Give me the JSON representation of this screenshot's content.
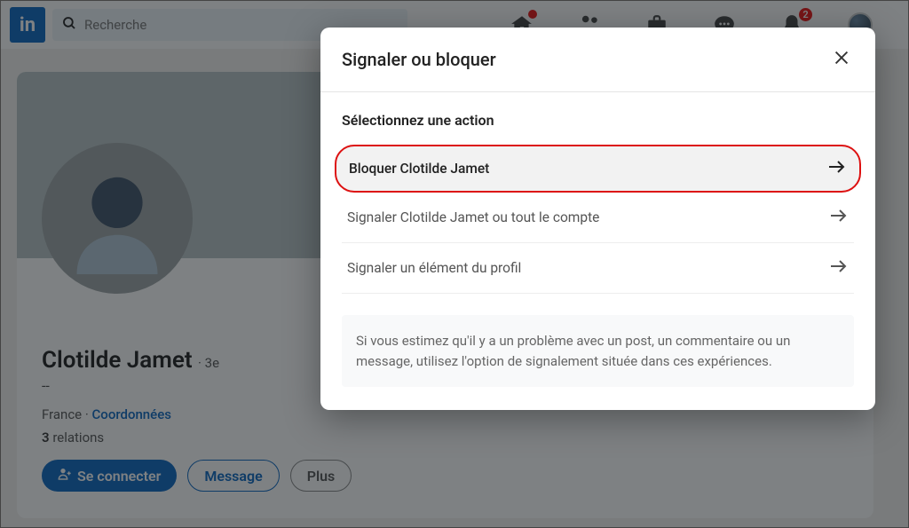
{
  "nav": {
    "search_placeholder": "Recherche",
    "home_dot": true,
    "notif_badge": "2"
  },
  "profile": {
    "name": "Clotilde Jamet",
    "degree": "3e",
    "headline": "--",
    "location": "France",
    "coords_label": "Coordonnées",
    "rel_count": "3",
    "rel_label": "relations",
    "connect": "Se connecter",
    "message": "Message",
    "more": "Plus"
  },
  "modal": {
    "title": "Signaler ou bloquer",
    "subtitle": "Sélectionnez une action",
    "opt_block": "Bloquer Clotilde Jamet",
    "opt_report_acct": "Signaler Clotilde Jamet ou tout le compte",
    "opt_report_item": "Signaler un élément du profil",
    "info": "Si vous estimez qu'il y a un problème avec un post, un commentaire ou un message, utilisez l'option de signalement située dans ces expériences."
  }
}
